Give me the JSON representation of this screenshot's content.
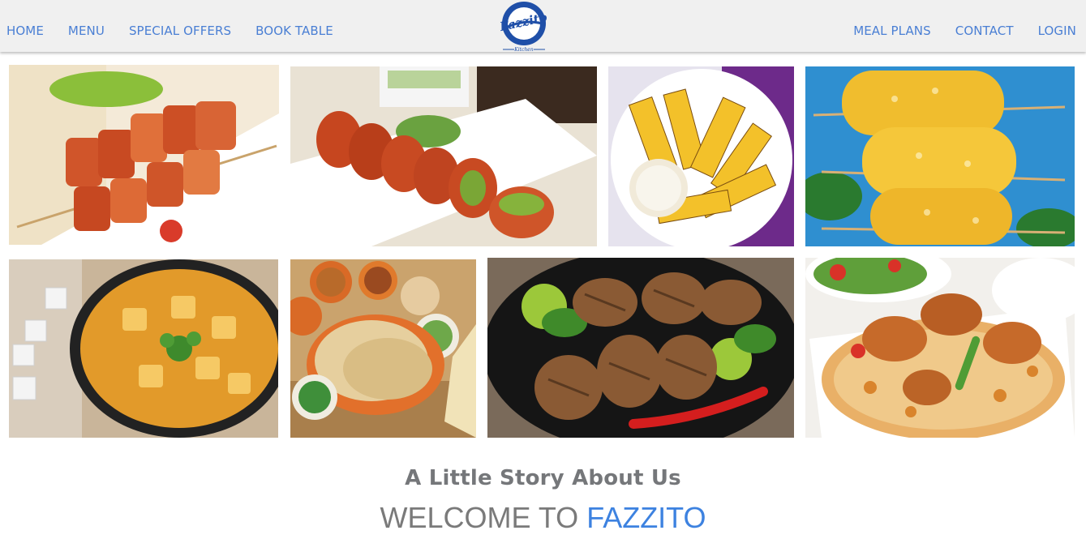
{
  "nav": {
    "left": [
      "HOME",
      "MENU",
      "SPECIAL OFFERS",
      "BOOK TABLE"
    ],
    "right": [
      "MEAL PLANS",
      "CONTACT",
      "LOGIN"
    ]
  },
  "logo": {
    "name": "Fazzito",
    "subtitle": "Kitchen",
    "icon": "fazzito-logo"
  },
  "gallery": [
    {
      "name": "paneer-tikka-image",
      "subject": "paneer tikka skewers"
    },
    {
      "name": "kebab-rolls-image",
      "subject": "stuffed kebab rolls"
    },
    {
      "name": "grilled-pineapple-image",
      "subject": "grilled pineapple with dip"
    },
    {
      "name": "corn-skewers-image",
      "subject": "grilled corn skewers"
    },
    {
      "name": "paneer-curry-image",
      "subject": "paneer curry bowl"
    },
    {
      "name": "indian-thali-image",
      "subject": "chapati and dals"
    },
    {
      "name": "grilled-chicken-image",
      "subject": "grilled chicken drumsticks"
    },
    {
      "name": "chicken-biryani-image",
      "subject": "chicken biryani"
    }
  ],
  "story": {
    "heading": "A Little Story About Us",
    "welcome_prefix": "WELCOME TO ",
    "welcome_brand": "FAZZITO"
  },
  "colors": {
    "nav_link": "#4a7fd4",
    "nav_bg": "#f0f0f0",
    "heading_gray": "#75777a",
    "brand_blue": "#3d82e0"
  }
}
